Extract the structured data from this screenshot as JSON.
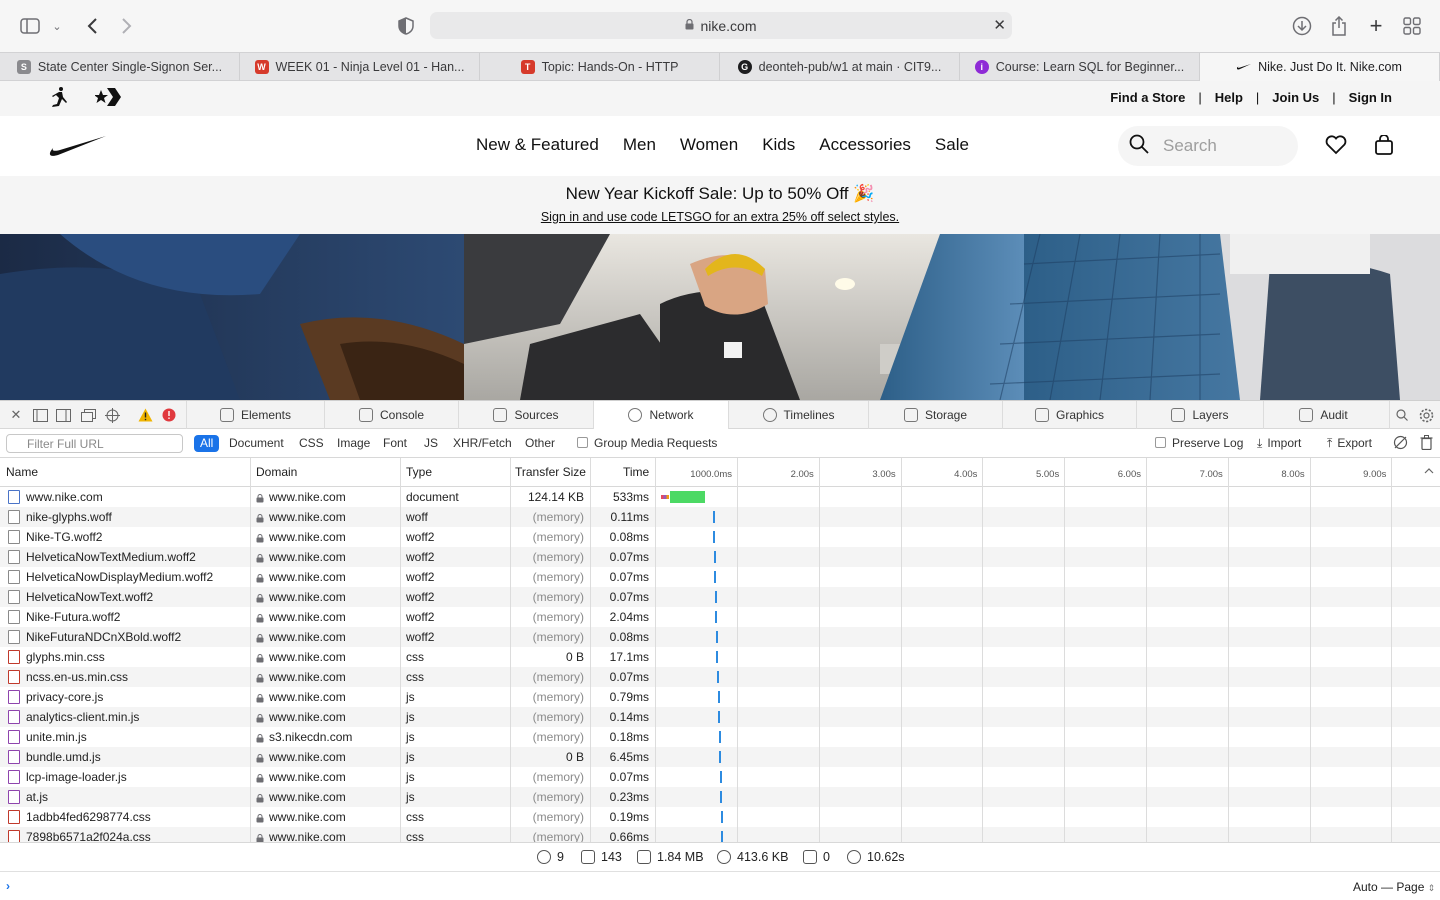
{
  "browser": {
    "url": "nike.com",
    "tabs": [
      {
        "title": "State Center Single-Signon Ser...",
        "favicon": "S",
        "color": "#8a8a8e"
      },
      {
        "title": "WEEK 01 - Ninja Level 01 - Han...",
        "favicon": "W",
        "color": "#d63a2b"
      },
      {
        "title": "Topic: Hands-On - HTTP",
        "favicon": "T",
        "color": "#d63a2b"
      },
      {
        "title": "deonteh-pub/w1 at main · CIT9...",
        "favicon": "G",
        "color": "#1d1d1f"
      },
      {
        "title": "Course: Learn SQL for Beginner...",
        "favicon": "i",
        "color": "#8e2bd6"
      },
      {
        "title": "Nike. Just Do It. Nike.com",
        "favicon": "✓",
        "color": "#ffffff"
      }
    ]
  },
  "nike": {
    "top_links": [
      "Find a Store",
      "Help",
      "Join Us",
      "Sign In"
    ],
    "nav": [
      "New & Featured",
      "Men",
      "Women",
      "Kids",
      "Accessories",
      "Sale"
    ],
    "search_placeholder": "Search",
    "promo_title": "New Year Kickoff Sale: Up to 50% Off 🎉",
    "promo_sub": "Sign in and use code LETSGO for an extra 25% off select styles."
  },
  "devtools": {
    "tabs": [
      "Elements",
      "Console",
      "Sources",
      "Network",
      "Timelines",
      "Storage",
      "Graphics",
      "Layers",
      "Audit"
    ],
    "active_tab": "Network",
    "filter_placeholder": "Filter Full URL",
    "filter_types": [
      "All",
      "Document",
      "CSS",
      "Image",
      "Font",
      "JS",
      "XHR/Fetch",
      "Other"
    ],
    "group_media": "Group Media Requests",
    "preserve_log": "Preserve Log",
    "import": "Import",
    "export": "Export",
    "columns": [
      "Name",
      "Domain",
      "Type",
      "Transfer Size",
      "Time"
    ],
    "timeline_ticks": [
      "1000.0ms",
      "2.00s",
      "3.00s",
      "4.00s",
      "5.00s",
      "6.00s",
      "7.00s",
      "8.00s",
      "9.00s"
    ],
    "rows": [
      {
        "name": "www.nike.com",
        "domain": "www.nike.com",
        "type": "document",
        "size": "124.14 KB",
        "time": "533ms"
      },
      {
        "name": "nike-glyphs.woff",
        "domain": "www.nike.com",
        "type": "woff",
        "size": "(memory)",
        "time": "0.11ms"
      },
      {
        "name": "Nike-TG.woff2",
        "domain": "www.nike.com",
        "type": "woff2",
        "size": "(memory)",
        "time": "0.08ms"
      },
      {
        "name": "HelveticaNowTextMedium.woff2",
        "domain": "www.nike.com",
        "type": "woff2",
        "size": "(memory)",
        "time": "0.07ms"
      },
      {
        "name": "HelveticaNowDisplayMedium.woff2",
        "domain": "www.nike.com",
        "type": "woff2",
        "size": "(memory)",
        "time": "0.07ms"
      },
      {
        "name": "HelveticaNowText.woff2",
        "domain": "www.nike.com",
        "type": "woff2",
        "size": "(memory)",
        "time": "0.07ms"
      },
      {
        "name": "Nike-Futura.woff2",
        "domain": "www.nike.com",
        "type": "woff2",
        "size": "(memory)",
        "time": "2.04ms"
      },
      {
        "name": "NikeFuturaNDCnXBold.woff2",
        "domain": "www.nike.com",
        "type": "woff2",
        "size": "(memory)",
        "time": "0.08ms"
      },
      {
        "name": "glyphs.min.css",
        "domain": "www.nike.com",
        "type": "css",
        "size": "0 B",
        "time": "17.1ms"
      },
      {
        "name": "ncss.en-us.min.css",
        "domain": "www.nike.com",
        "type": "css",
        "size": "(memory)",
        "time": "0.07ms"
      },
      {
        "name": "privacy-core.js",
        "domain": "www.nike.com",
        "type": "js",
        "size": "(memory)",
        "time": "0.79ms"
      },
      {
        "name": "analytics-client.min.js",
        "domain": "www.nike.com",
        "type": "js",
        "size": "(memory)",
        "time": "0.14ms"
      },
      {
        "name": "unite.min.js",
        "domain": "s3.nikecdn.com",
        "type": "js",
        "size": "(memory)",
        "time": "0.18ms"
      },
      {
        "name": "bundle.umd.js",
        "domain": "www.nike.com",
        "type": "js",
        "size": "0 B",
        "time": "6.45ms"
      },
      {
        "name": "lcp-image-loader.js",
        "domain": "www.nike.com",
        "type": "js",
        "size": "(memory)",
        "time": "0.07ms"
      },
      {
        "name": "at.js",
        "domain": "www.nike.com",
        "type": "js",
        "size": "(memory)",
        "time": "0.23ms"
      },
      {
        "name": "1adbb4fed6298774.css",
        "domain": "www.nike.com",
        "type": "css",
        "size": "(memory)",
        "time": "0.19ms"
      },
      {
        "name": "7898b6571a2f024a.css",
        "domain": "www.nike.com",
        "type": "css",
        "size": "(memory)",
        "time": "0.66ms"
      }
    ],
    "status": {
      "domains": "9",
      "resources": "143",
      "size": "1.84 MB",
      "transferred": "413.6 KB",
      "errors": "0",
      "time": "10.62s"
    },
    "console_mode": "Auto — Page"
  }
}
